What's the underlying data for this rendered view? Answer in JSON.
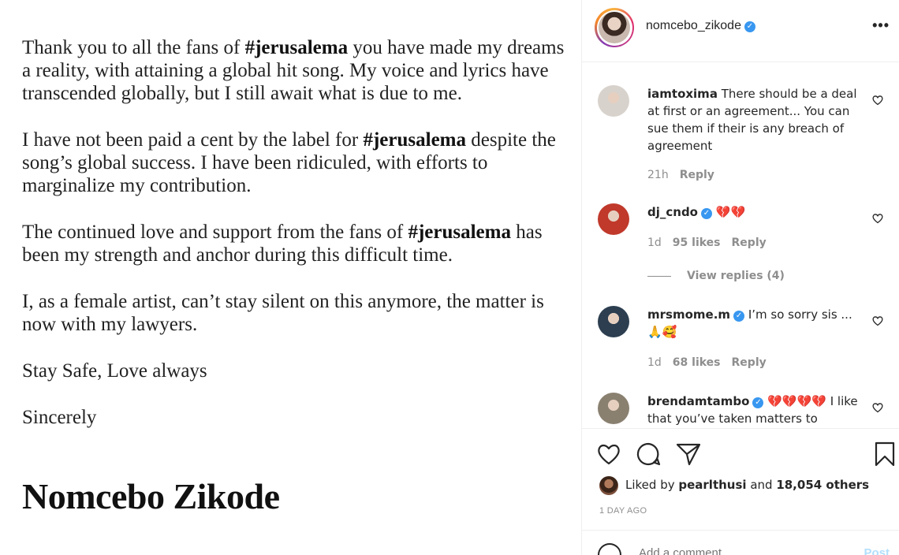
{
  "post": {
    "paragraphs": [
      {
        "parts": [
          {
            "t": "Thank you to all the fans of ",
            "b": false
          },
          {
            "t": "#jerusalema",
            "b": true
          },
          {
            "t": " you have made my dreams a reality, with attaining a global hit song. My voice and lyrics have transcended globally, but I still await what is due to me.",
            "b": false
          }
        ]
      },
      {
        "parts": [
          {
            "t": "I have not been paid a cent by the label for ",
            "b": false
          },
          {
            "t": "#jerusalema",
            "b": true
          },
          {
            "t": " despite the song’s global success. I have been ridiculed, with efforts to marginalize my contribution.",
            "b": false
          }
        ]
      },
      {
        "parts": [
          {
            "t": "The continued love and support from the fans of ",
            "b": false
          },
          {
            "t": "#jerusalema",
            "b": true
          },
          {
            "t": " has been my strength and anchor during this difficult time.",
            "b": false
          }
        ]
      },
      {
        "parts": [
          {
            "t": "I, as a female artist, can’t stay silent on this anymore, the matter is now with my lawyers.",
            "b": false
          }
        ]
      },
      {
        "parts": [
          {
            "t": "Stay Safe, Love always",
            "b": false
          }
        ]
      },
      {
        "parts": [
          {
            "t": "Sincerely",
            "b": false
          }
        ]
      }
    ],
    "signature": "Nomcebo Zikode"
  },
  "header": {
    "username": "nomcebo_zikode",
    "verified_mark": "✓",
    "more_label": "•••"
  },
  "comments": [
    {
      "user": "iamtoxima",
      "verified": false,
      "text": "There should be a deal at first or an agreement... You can sue them if their is any breach of agreement",
      "time": "21h",
      "likes": "",
      "reply": "Reply",
      "avatar_color": "#d8d2cc"
    },
    {
      "user": "dj_cndo",
      "verified": true,
      "text": "💔💔",
      "time": "1d",
      "likes": "95 likes",
      "reply": "Reply",
      "view_replies": "View replies (4)",
      "avatar_color": "#c0392b"
    },
    {
      "user": "mrsmome.m",
      "verified": true,
      "text": "I’m so sorry sis ... 🙏🥰",
      "time": "1d",
      "likes": "68 likes",
      "reply": "Reply",
      "avatar_color": "#2c3e50"
    },
    {
      "user": "brendamtambo",
      "verified": true,
      "text": "💔💔💔💔 I like that you’ve taken matters to",
      "time": "",
      "likes": "",
      "reply": "",
      "avatar_color": "#8a8070"
    }
  ],
  "likes": {
    "prefix": "Liked by ",
    "user": "pearlthusi",
    "middle": " and ",
    "count": "18,054 others"
  },
  "date": "1 DAY AGO",
  "add_comment": {
    "placeholder": "Add a comment...",
    "post_label": "Post"
  },
  "icons": [
    "heart-icon",
    "comment-icon",
    "share-icon",
    "bookmark-icon",
    "emoji-icon",
    "more-icon",
    "verified-icon"
  ]
}
